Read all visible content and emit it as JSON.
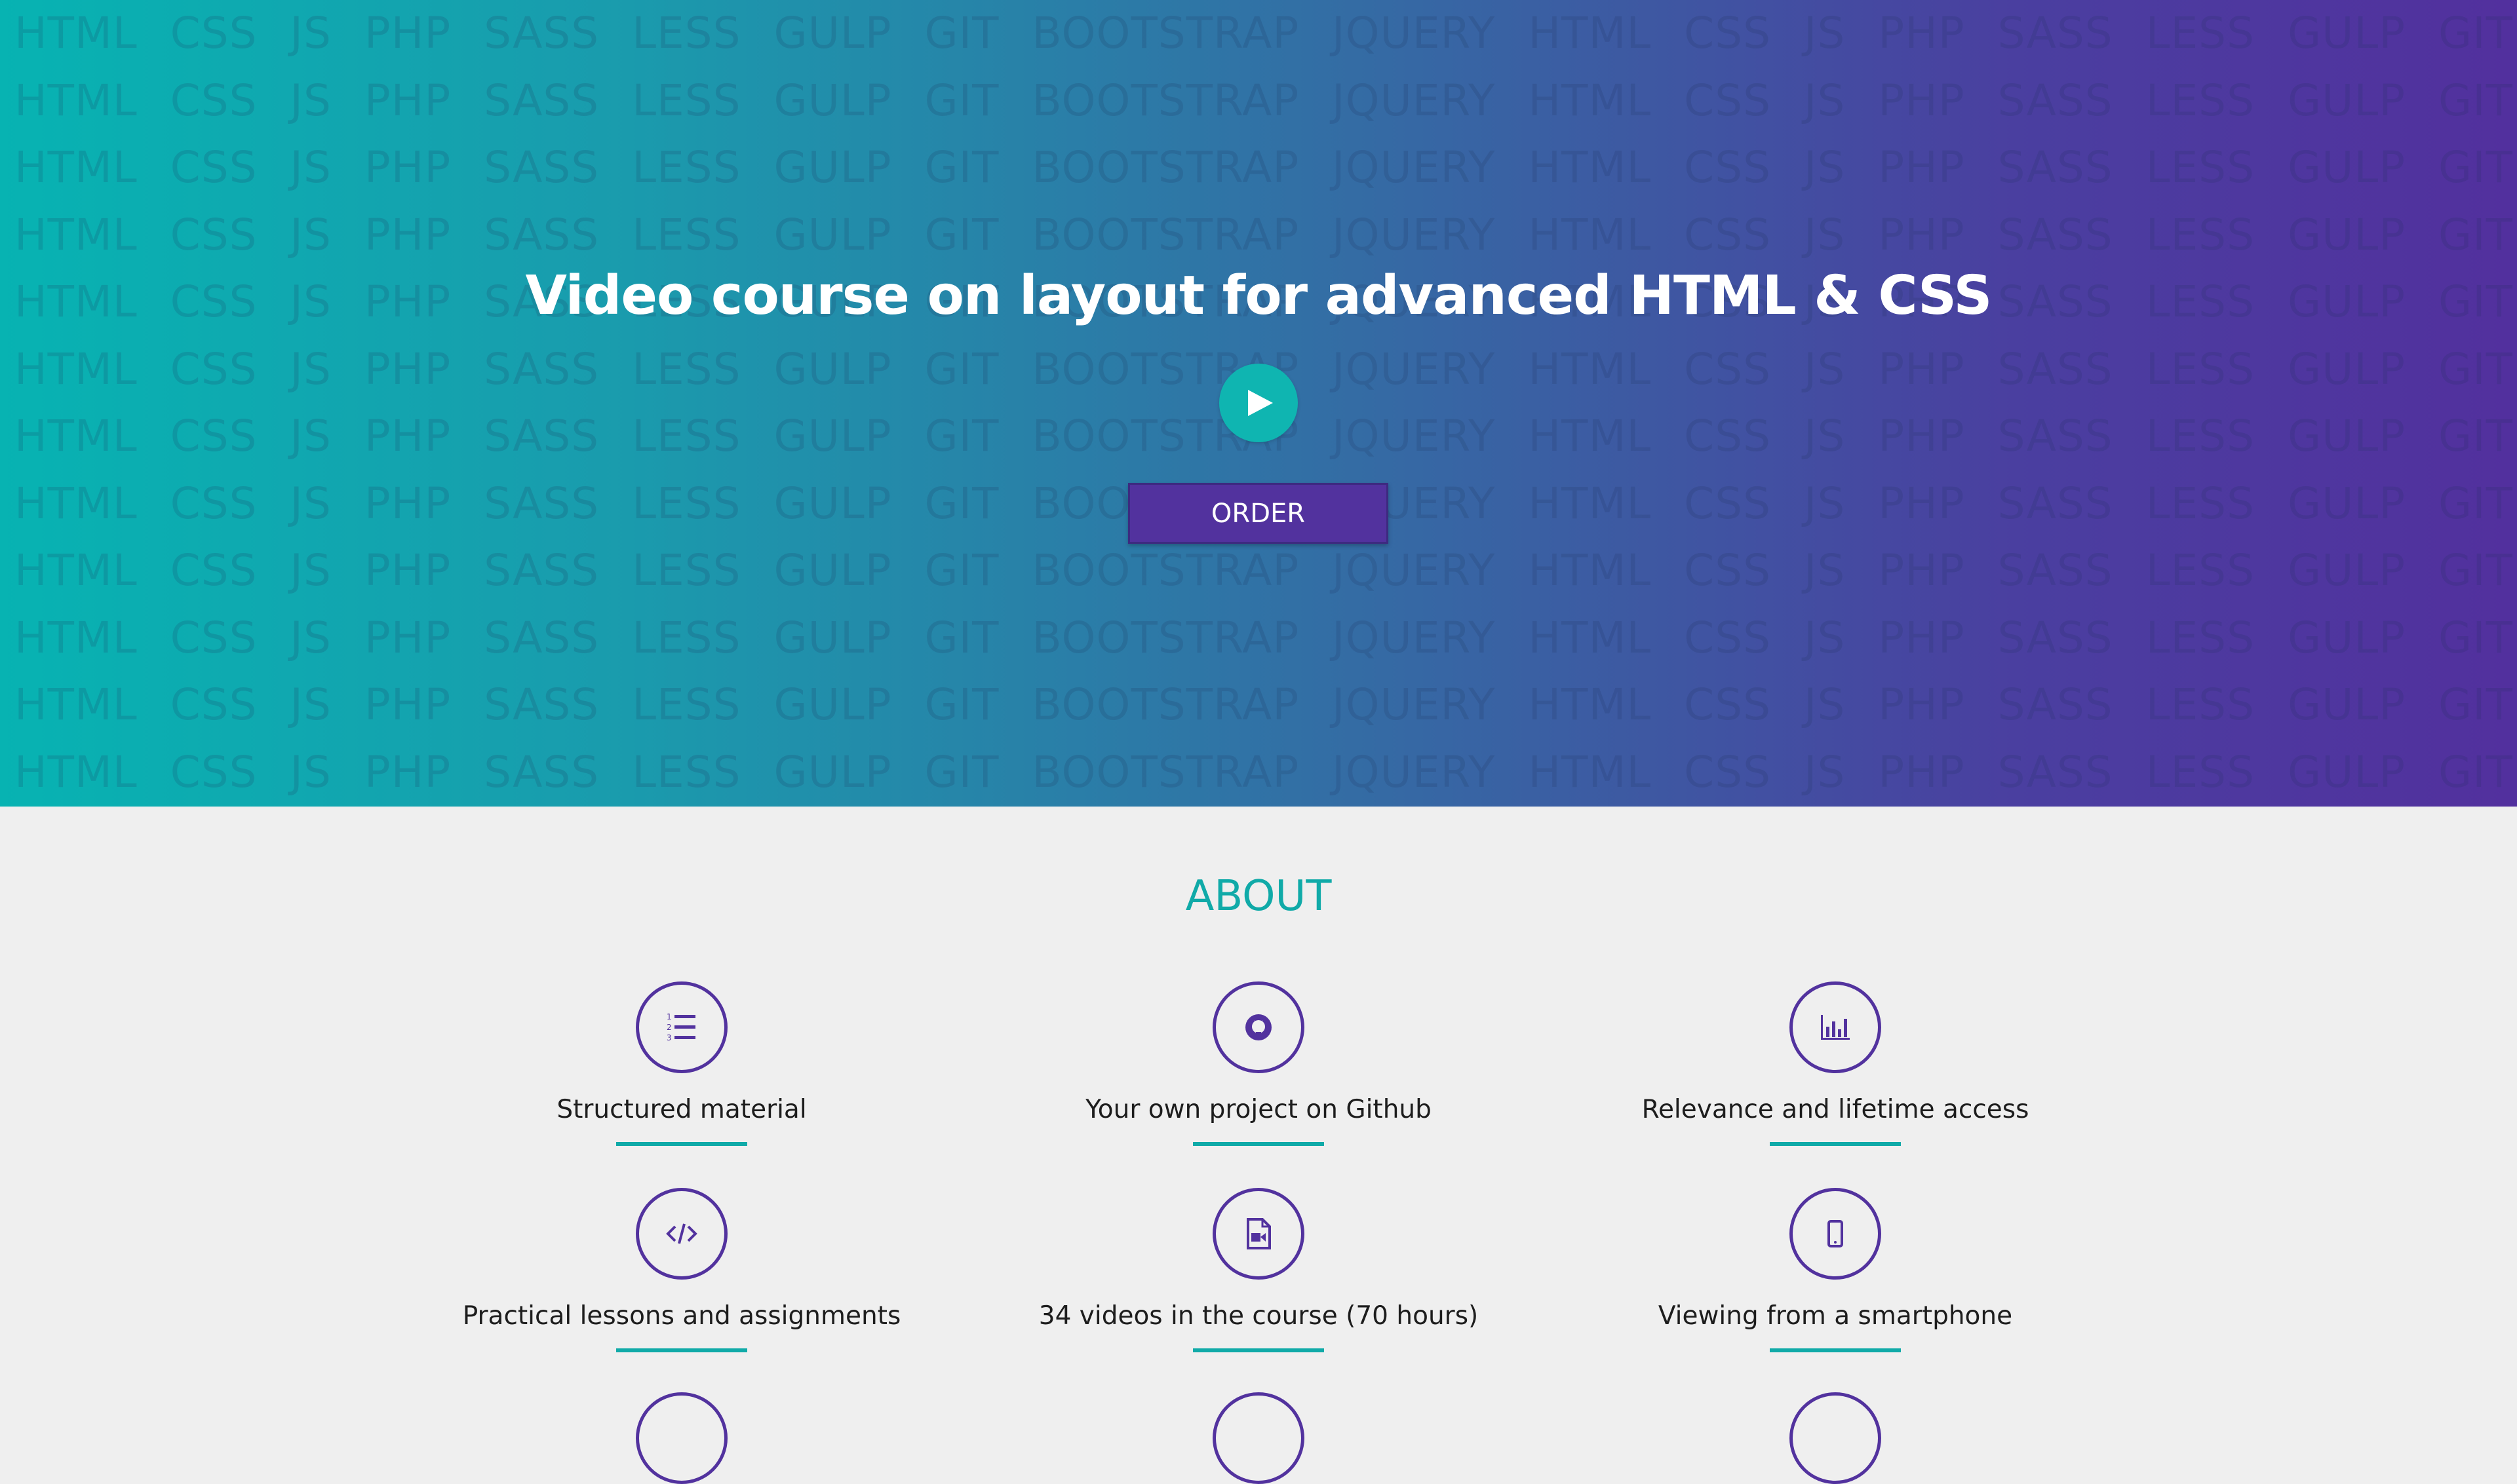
{
  "hero": {
    "title": "Video course on layout for advanced HTML & CSS",
    "order_label": "ORDER",
    "watermark_words": [
      "HTML",
      "CSS",
      "JS",
      "PHP",
      "SASS",
      "LESS",
      "GULP",
      "GIT",
      "BOOTSTRAP",
      "JQUERY",
      "HTML",
      "CSS",
      "JS",
      "PHP",
      "SASS",
      "LESS",
      "GULP",
      "GIT",
      "BOOTSTRAP"
    ],
    "gradient_start": "#07b3b2",
    "gradient_end": "#52309e"
  },
  "about": {
    "title": "ABOUT",
    "features": [
      {
        "label": "Structured material",
        "icon": "list-icon"
      },
      {
        "label": "Your own project on Github",
        "icon": "github-icon"
      },
      {
        "label": "Relevance and lifetime access",
        "icon": "bar-chart-icon"
      },
      {
        "label": "Practical lessons and assignments",
        "icon": "code-icon"
      },
      {
        "label": "34 videos in the course (70 hours)",
        "icon": "video-file-icon"
      },
      {
        "label": "Viewing from a smartphone",
        "icon": "smartphone-icon"
      }
    ]
  },
  "colors": {
    "accent_teal": "#10aaa8",
    "accent_purple": "#52329e",
    "background": "#efefef"
  }
}
